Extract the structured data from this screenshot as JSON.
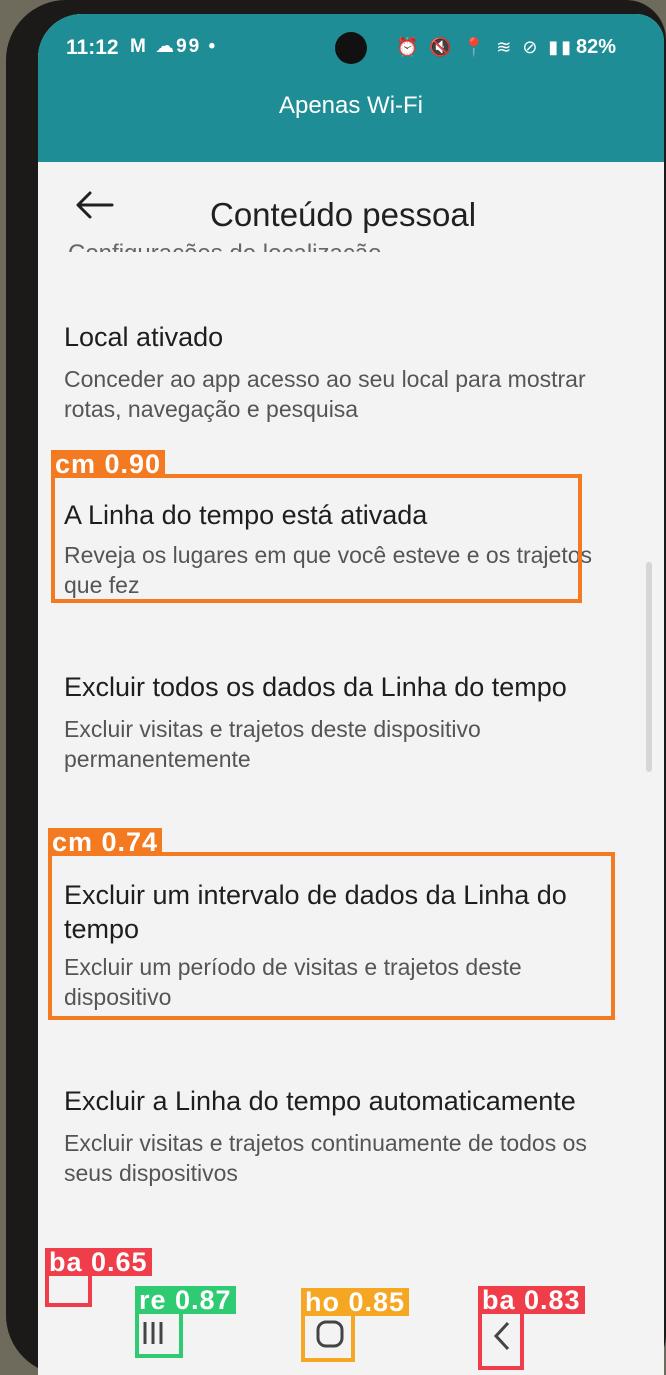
{
  "status_bar": {
    "time": "11:12",
    "left_icons": "M ☁99 •",
    "right_icons": "⏰ 🔇 📍 ≋ ⊘ ▮▮",
    "battery": "82%"
  },
  "banner": "Apenas Wi-Fi",
  "header": {
    "title": "Conteúdo pessoal",
    "back_icon": "arrow-left-icon"
  },
  "cut_off_text": "Configurações de localização",
  "settings_items": [
    {
      "title": "Local ativado",
      "description": "Conceder ao app acesso ao seu local para mostrar rotas, navegação e pesquisa"
    },
    {
      "title": "A Linha do tempo está ativada",
      "description": "Reveja os lugares em que você esteve e os trajetos que fez"
    },
    {
      "title": "Excluir todos os dados da Linha do tempo",
      "description": "Excluir visitas e trajetos deste dispositivo permanentemente"
    },
    {
      "title": "Excluir um intervalo de dados da Linha do tempo",
      "description": "Excluir um período de visitas e trajetos deste dispositivo"
    },
    {
      "title": "Excluir a Linha do tempo automaticamente",
      "description": "Excluir visitas e trajetos continuamente de todos os seus dispositivos"
    }
  ],
  "nav_bar": {
    "recents_icon": "recents-icon",
    "home_icon": "home-icon",
    "back_icon": "back-chevron-icon"
  },
  "detections": [
    {
      "label": "cm 0.90",
      "color": "#f47a22"
    },
    {
      "label": "cm 0.74",
      "color": "#f47a22"
    },
    {
      "label": "ba 0.65",
      "color": "#ef3e4a"
    },
    {
      "label": "re 0.87",
      "color": "#2fcb72"
    },
    {
      "label": "ho 0.85",
      "color": "#f5a623"
    },
    {
      "label": "ba 0.83",
      "color": "#ef3e4a"
    }
  ]
}
